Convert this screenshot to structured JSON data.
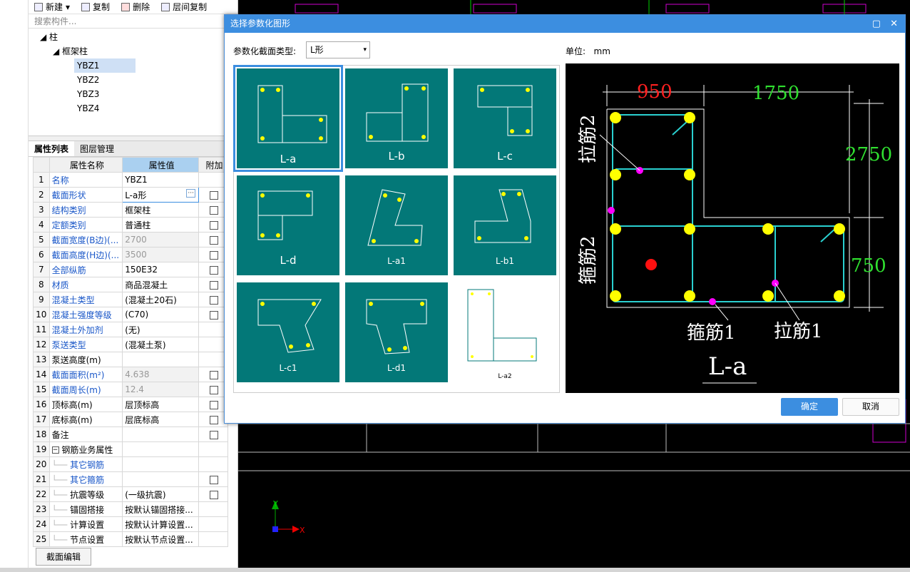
{
  "toolbar": {
    "new_label": "新建",
    "copy_label": "复制",
    "delete_label": "删除",
    "layer_copy_label": "层间复制"
  },
  "search": {
    "placeholder": "搜索构件..."
  },
  "tree": {
    "root": "柱",
    "group": "框架柱",
    "items": [
      "YBZ1",
      "YBZ2",
      "YBZ3",
      "YBZ4"
    ],
    "selected": "YBZ1"
  },
  "tabs": {
    "props": "属性列表",
    "layers": "图层管理"
  },
  "table": {
    "headers": [
      "属性名称",
      "属性值",
      "附加"
    ],
    "rows": [
      {
        "n": "1",
        "name": "名称",
        "value": "YBZ1"
      },
      {
        "n": "2",
        "name": "截面形状",
        "value": "L-a形"
      },
      {
        "n": "3",
        "name": "结构类别",
        "value": "框架柱"
      },
      {
        "n": "4",
        "name": "定额类别",
        "value": "普通柱"
      },
      {
        "n": "5",
        "name": "截面宽度(B边)(...",
        "value": "2700"
      },
      {
        "n": "6",
        "name": "截面高度(H边)(...",
        "value": "3500"
      },
      {
        "n": "7",
        "name": "全部纵筋",
        "value": "150E32"
      },
      {
        "n": "8",
        "name": "材质",
        "value": "商品混凝土"
      },
      {
        "n": "9",
        "name": "混凝土类型",
        "value": "(混凝土20石)"
      },
      {
        "n": "10",
        "name": "混凝土强度等级",
        "value": "(C70)"
      },
      {
        "n": "11",
        "name": "混凝土外加剂",
        "value": "(无)"
      },
      {
        "n": "12",
        "name": "泵送类型",
        "value": "(混凝土泵)"
      },
      {
        "n": "13",
        "name": "泵送高度(m)",
        "value": ""
      },
      {
        "n": "14",
        "name": "截面面积(m²)",
        "value": "4.638"
      },
      {
        "n": "15",
        "name": "截面周长(m)",
        "value": "12.4"
      },
      {
        "n": "16",
        "name": "顶标高(m)",
        "value": "层顶标高"
      },
      {
        "n": "17",
        "name": "底标高(m)",
        "value": "层底标高"
      },
      {
        "n": "18",
        "name": "备注",
        "value": ""
      },
      {
        "n": "19",
        "name": "钢筋业务属性",
        "value": ""
      },
      {
        "n": "20",
        "name": "其它钢筋",
        "value": ""
      },
      {
        "n": "21",
        "name": "其它箍筋",
        "value": ""
      },
      {
        "n": "22",
        "name": "抗震等级",
        "value": "(一级抗震)"
      },
      {
        "n": "23",
        "name": "锚固搭接",
        "value": "按默认锚固搭接..."
      },
      {
        "n": "24",
        "name": "计算设置",
        "value": "按默认计算设置..."
      },
      {
        "n": "25",
        "name": "节点设置",
        "value": "按默认节点设置..."
      }
    ]
  },
  "bottom_button": "截面编辑",
  "dialog": {
    "title": "选择参数化图形",
    "type_label": "参数化截面类型:",
    "type_value": "L形",
    "unit_label": "单位:",
    "unit_value": "mm",
    "thumbs": [
      "L-a",
      "L-b",
      "L-c",
      "L-d",
      "L-a1",
      "L-b1",
      "L-c1",
      "L-d1",
      "L-a2"
    ],
    "preview": {
      "dim_top_left": "950",
      "dim_top_right": "1750",
      "dim_right_top": "2750",
      "dim_right_bottom": "750",
      "label_tie_left": "拉筋2",
      "label_stirrup_left": "箍筋2",
      "label_stirrup_bottom": "箍筋1",
      "label_tie_bottom": "拉筋1",
      "name": "L-a"
    },
    "ok_label": "确定",
    "cancel_label": "取消"
  },
  "axis": {
    "x": "X",
    "y": "Y"
  },
  "colors": {
    "accent": "#3c8ee0",
    "thumb_bg": "#037878",
    "rebar": "#ffff00",
    "tie": "#ff00ff"
  }
}
